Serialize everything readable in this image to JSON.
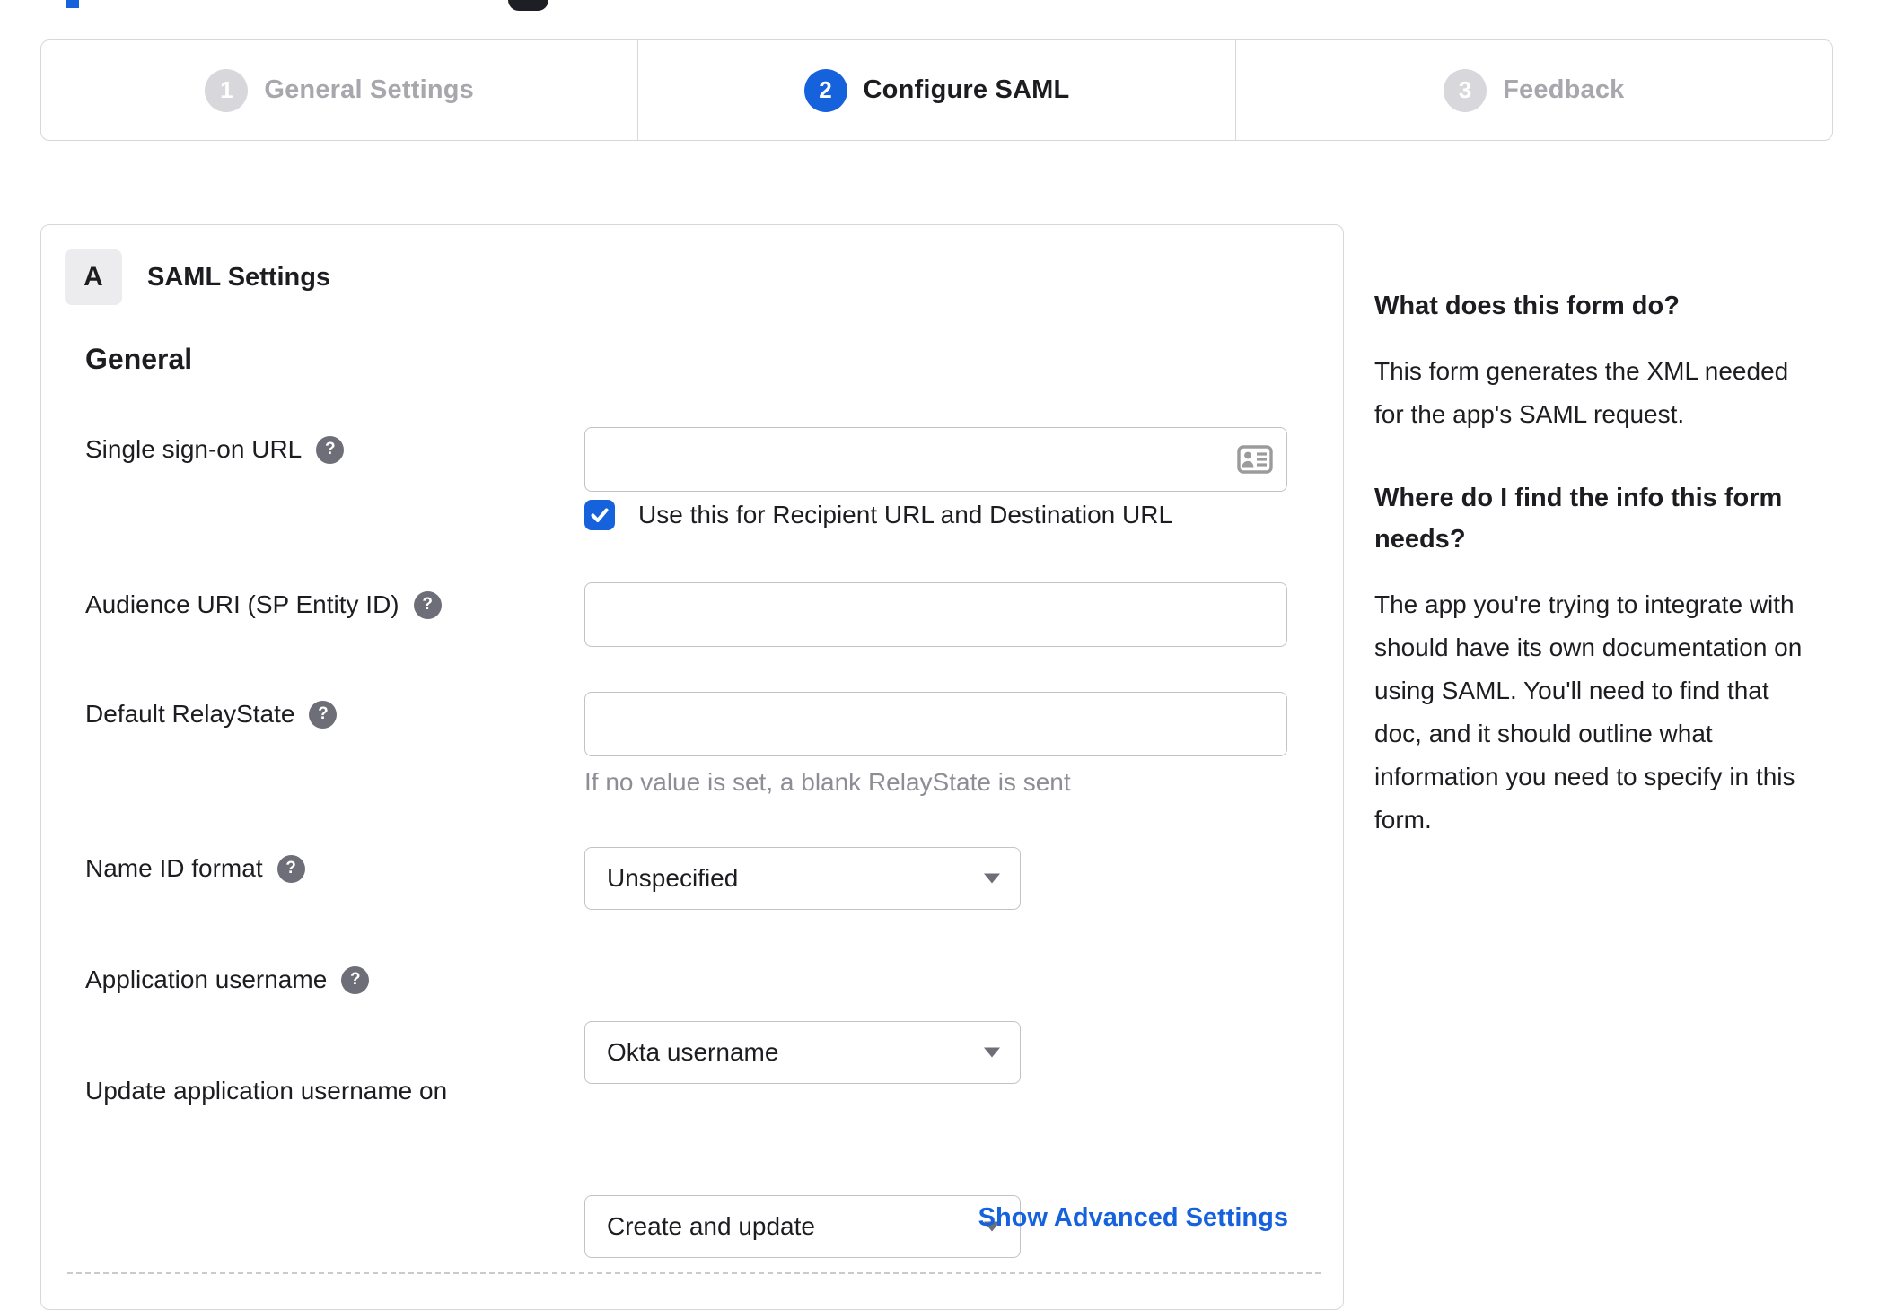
{
  "colors": {
    "accent_blue": "#1662dd",
    "text_dark": "#1d1d21",
    "inactive_gray": "#a7a7ad",
    "border_gray": "#d7d7dc",
    "hint_gray": "#8d8d95"
  },
  "icons": {
    "help_glyph": "?"
  },
  "stepper": {
    "steps": [
      {
        "number": "1",
        "label": "General Settings",
        "state": "inactive"
      },
      {
        "number": "2",
        "label": "Configure SAML",
        "state": "active"
      },
      {
        "number": "3",
        "label": "Feedback",
        "state": "inactive"
      }
    ]
  },
  "panel": {
    "badge": "A",
    "title": "SAML Settings",
    "section": "General",
    "fields": {
      "sso": {
        "label": "Single sign-on URL",
        "value": "",
        "checkbox_label": "Use this for Recipient URL and Destination URL",
        "checkbox_checked": true
      },
      "audience": {
        "label": "Audience URI (SP Entity ID)",
        "value": ""
      },
      "relaystate": {
        "label": "Default RelayState",
        "value": "",
        "hint": "If no value is set, a blank RelayState is sent"
      },
      "nameid": {
        "label": "Name ID format",
        "value": "Unspecified"
      },
      "appusername": {
        "label": "Application username",
        "value": "Okta username"
      },
      "update_username": {
        "label": "Update application username on",
        "value": "Create and update"
      }
    },
    "advanced_link": "Show Advanced Settings"
  },
  "sidebar": {
    "q1": "What does this form do?",
    "a1": "This form generates the XML needed\nfor the app's SAML request.",
    "q2": "Where do I find the info this form\nneeds?",
    "a2": "The app you're trying to integrate with\nshould have its own documentation on\nusing SAML. You'll need to find that\ndoc, and it should outline what\ninformation you need to specify in this\nform."
  }
}
